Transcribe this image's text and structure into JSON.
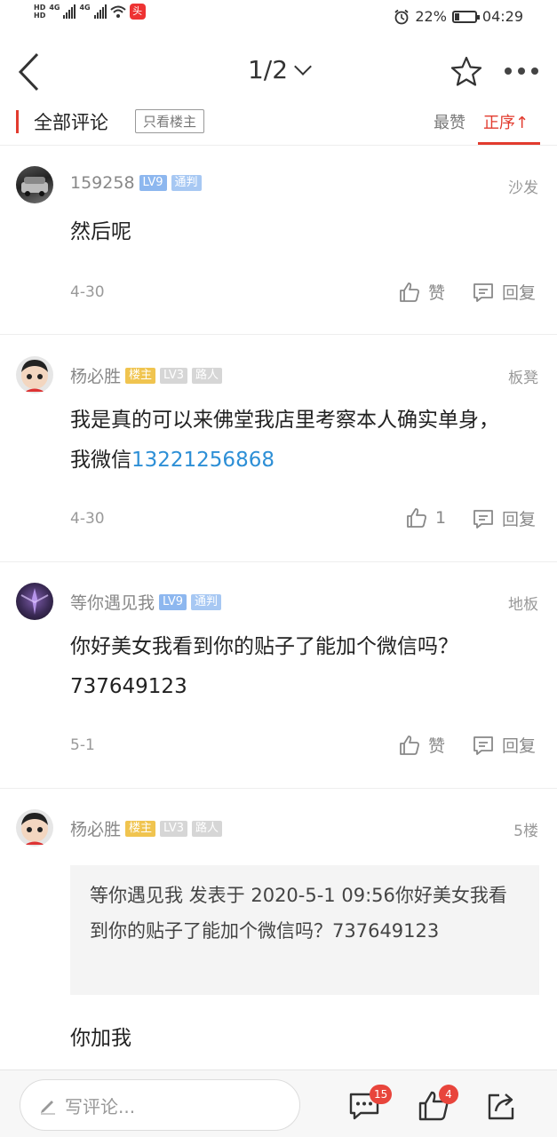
{
  "status": {
    "battery_pct": "22%",
    "time": "04:29",
    "net1": "4G",
    "net2": "4G"
  },
  "nav": {
    "pager": "1/2"
  },
  "filter": {
    "all_comments": "全部评论",
    "only_op": "只看楼主",
    "sort_hot": "最赞",
    "sort_order": "正序↑"
  },
  "comments": [
    {
      "username": "159258",
      "badges": [
        "LV9",
        "通判"
      ],
      "floor": "沙发",
      "text": "然后呢",
      "date": "4-30",
      "like": "赞",
      "reply": "回复"
    },
    {
      "username": "杨必胜",
      "badges": [
        "楼主",
        "LV3",
        "路人"
      ],
      "floor": "板凳",
      "text": "我是真的可以来佛堂我店里考察本人确实单身，我微信",
      "phone": "13221256868",
      "date": "4-30",
      "like": "1",
      "reply": "回复"
    },
    {
      "username": "等你遇见我",
      "badges": [
        "LV9",
        "通判"
      ],
      "floor": "地板",
      "text": "你好美女我看到你的贴子了能加个微信吗？737649123",
      "date": "5-1",
      "like": "赞",
      "reply": "回复"
    },
    {
      "username": "杨必胜",
      "badges": [
        "楼主",
        "LV3",
        "路人"
      ],
      "floor": "5楼",
      "quote": "等你遇见我 发表于 2020-5-1 09:56你好美女我看到你的贴子了能加个微信吗？737649123",
      "text": "你加我"
    }
  ],
  "bottom": {
    "placeholder": "写评论...",
    "comments_count": "15",
    "likes_count": "4"
  },
  "icons": [
    "back-icon",
    "chevron-down-icon",
    "star-icon",
    "more-icon",
    "thumb-up-icon",
    "reply-icon",
    "pencil-icon",
    "comment-icon",
    "share-icon"
  ]
}
